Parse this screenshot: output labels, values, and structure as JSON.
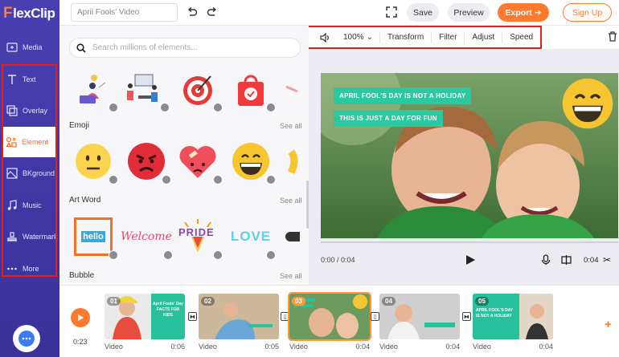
{
  "app": {
    "logo_f": "F",
    "logo_rest": "lexClip"
  },
  "header": {
    "project_title": "April Fools' Video",
    "save_label": "Save",
    "preview_label": "Preview",
    "export_label": "Export",
    "signup_label": "Sign Up"
  },
  "sidebar": {
    "items": [
      {
        "label": "Media",
        "icon": "media-icon"
      },
      {
        "label": "Text",
        "icon": "text-icon"
      },
      {
        "label": "Overlay",
        "icon": "overlay-icon"
      },
      {
        "label": "Element",
        "icon": "element-icon",
        "active": true
      },
      {
        "label": "BKground",
        "icon": "background-icon"
      },
      {
        "label": "Music",
        "icon": "music-icon"
      },
      {
        "label": "Watermark",
        "icon": "watermark-icon"
      },
      {
        "label": "More",
        "icon": "more-icon"
      }
    ]
  },
  "toolbar": {
    "volume_icon": "speaker-icon",
    "zoom": "100%",
    "transform": "Transform",
    "filter": "Filter",
    "adjust": "Adjust",
    "speed": "Speed"
  },
  "panel": {
    "search_placeholder": "Search millions of elements...",
    "sections": [
      {
        "title": "Emoji",
        "see_all": "See all"
      },
      {
        "title": "Art Word",
        "see_all": "See all"
      },
      {
        "title": "Bubble",
        "see_all": "See all"
      }
    ],
    "art_words": [
      "hello",
      "Welcome",
      "PRIDE",
      "LOVE"
    ]
  },
  "preview": {
    "caption_1": "APRIL FOOL'S DAY IS NOT A HOLIDAY",
    "caption_2": "THIS IS JUST A DAY FOR FUN",
    "time_current": "0:00 / 0:04",
    "time_right": "0:04"
  },
  "timeline": {
    "total_time": "0:23",
    "clips": [
      {
        "num": "01",
        "type": "Video",
        "duration": "0:06",
        "caption": "April Fools' Day FACTS FOR KIDS"
      },
      {
        "num": "02",
        "type": "Video",
        "duration": "0:05",
        "caption": ""
      },
      {
        "num": "03",
        "type": "Video",
        "duration": "0:04",
        "caption": "",
        "selected": true
      },
      {
        "num": "04",
        "type": "Video",
        "duration": "0:04",
        "caption": ""
      },
      {
        "num": "05",
        "type": "Video",
        "duration": "0:04",
        "caption": "APRIL FOOL'S DAY IS NOT A HOLIDAY"
      }
    ]
  },
  "colors": {
    "accent": "#ff7a2e",
    "sidebar": "#4a3fb0",
    "caption": "#2bc9a2",
    "highlight_box": "#e02020"
  }
}
